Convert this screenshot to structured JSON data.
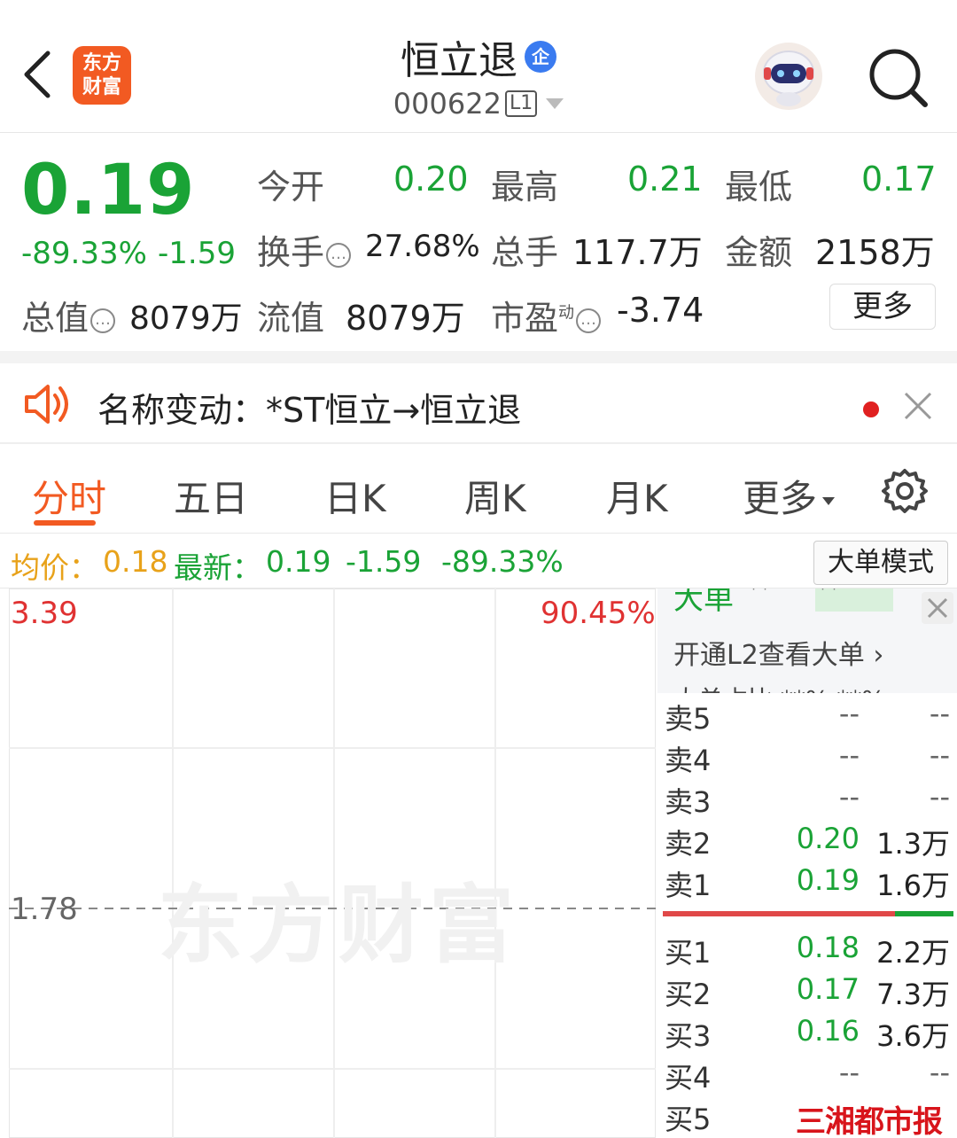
{
  "header": {
    "logo_line1": "东方",
    "logo_line2": "财富",
    "title": "恒立退",
    "badge": "企",
    "code": "000622",
    "level": "L1"
  },
  "quote": {
    "price": "0.19",
    "change_pct": "-89.33%",
    "change_abs": "-1.59",
    "fields": {
      "open_label": "今开",
      "open_value": "0.20",
      "high_label": "最高",
      "high_value": "0.21",
      "low_label": "最低",
      "low_value": "0.17",
      "turnover_label": "换手",
      "turnover_value": "27.68%",
      "volume_label": "总手",
      "volume_value": "117.7万",
      "amount_label": "金额",
      "amount_value": "2158万",
      "mktcap_label": "总值",
      "mktcap_value": "8079万",
      "float_label": "流值",
      "float_value": "8079万",
      "pe_label": "市盈",
      "pe_sup": "动",
      "pe_value": "-3.74"
    },
    "more_button": "更多"
  },
  "notice": {
    "text": "名称变动：*ST恒立→恒立退"
  },
  "tabs": [
    {
      "label": "分时"
    },
    {
      "label": "五日"
    },
    {
      "label": "日K"
    },
    {
      "label": "周K"
    },
    {
      "label": "月K"
    },
    {
      "label": "更多"
    }
  ],
  "legend": {
    "avg_label": "均价：",
    "avg_value": "0.18",
    "latest_label": "最新：",
    "latest_value": "0.19",
    "latest_change": "-1.59",
    "latest_pct": "-89.33%",
    "mode_button": "大单模式"
  },
  "chart": {
    "y_top": "3.39",
    "pct_top": "90.45%",
    "y_mid": "1.78",
    "watermark": "东方财富"
  },
  "side_panel": {
    "big_order_label": "大单",
    "stars1": "**",
    "stars2": "**",
    "open_l2": "开通L2查看大单 ›",
    "ratio_cut": "大单占比  **%  **%"
  },
  "order_book": {
    "asks": [
      {
        "name": "卖5",
        "price": "--",
        "volume": "--"
      },
      {
        "name": "卖4",
        "price": "--",
        "volume": "--"
      },
      {
        "name": "卖3",
        "price": "--",
        "volume": "--"
      },
      {
        "name": "卖2",
        "price": "0.20",
        "volume": "1.3万"
      },
      {
        "name": "卖1",
        "price": "0.19",
        "volume": "1.6万"
      }
    ],
    "bids": [
      {
        "name": "买1",
        "price": "0.18",
        "volume": "2.2万"
      },
      {
        "name": "买2",
        "price": "0.17",
        "volume": "7.3万"
      },
      {
        "name": "买3",
        "price": "0.16",
        "volume": "3.6万"
      },
      {
        "name": "买4",
        "price": "--",
        "volume": "--"
      },
      {
        "name": "买5",
        "price": "",
        "volume": ""
      }
    ]
  },
  "brand_mark": "三湘都市报"
}
